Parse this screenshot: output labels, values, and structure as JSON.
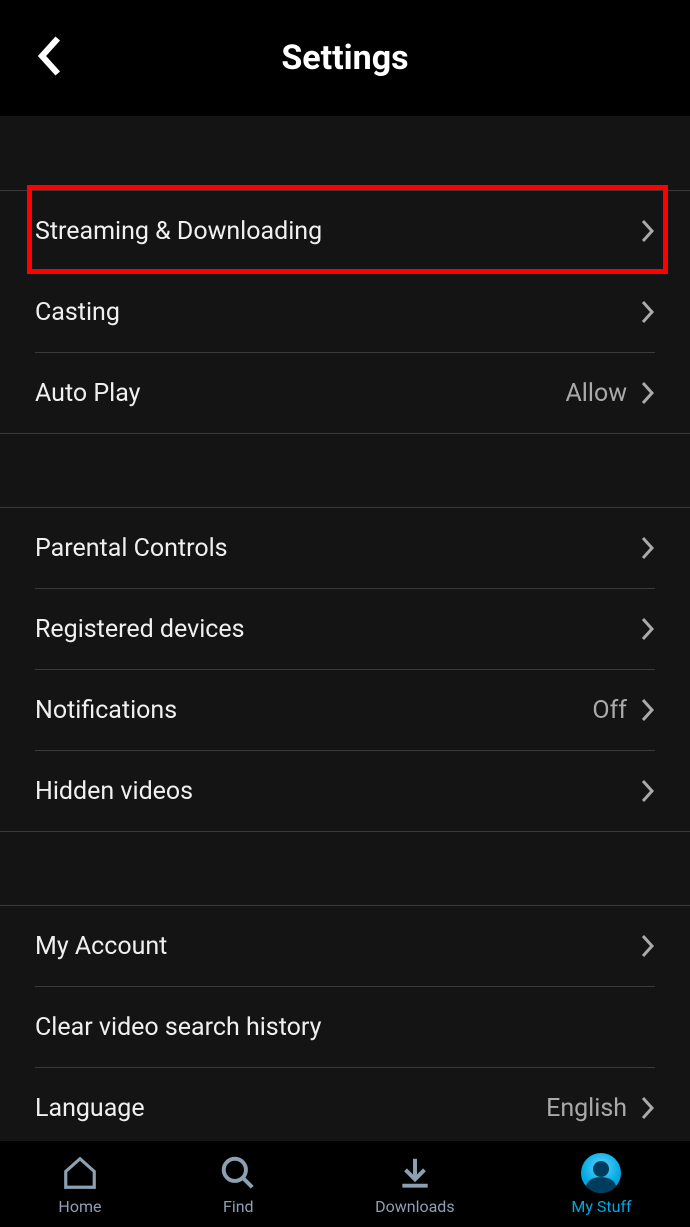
{
  "header": {
    "title": "Settings"
  },
  "sections": [
    {
      "rows": [
        {
          "label": "Streaming & Downloading",
          "value": "",
          "chevron": true
        },
        {
          "label": "Casting",
          "value": "",
          "chevron": true
        },
        {
          "label": "Auto Play",
          "value": "Allow",
          "chevron": true
        }
      ]
    },
    {
      "rows": [
        {
          "label": "Parental Controls",
          "value": "",
          "chevron": true
        },
        {
          "label": "Registered devices",
          "value": "",
          "chevron": true
        },
        {
          "label": "Notifications",
          "value": "Off",
          "chevron": true
        },
        {
          "label": "Hidden videos",
          "value": "",
          "chevron": true
        }
      ]
    },
    {
      "rows": [
        {
          "label": "My Account",
          "value": "",
          "chevron": true
        },
        {
          "label": "Clear video search history",
          "value": "",
          "chevron": false
        },
        {
          "label": "Language",
          "value": "English",
          "chevron": true
        }
      ]
    }
  ],
  "nav": {
    "items": [
      {
        "label": "Home",
        "icon": "home",
        "active": false
      },
      {
        "label": "Find",
        "icon": "search",
        "active": false
      },
      {
        "label": "Downloads",
        "icon": "download",
        "active": false
      },
      {
        "label": "My Stuff",
        "icon": "avatar",
        "active": true
      }
    ]
  }
}
